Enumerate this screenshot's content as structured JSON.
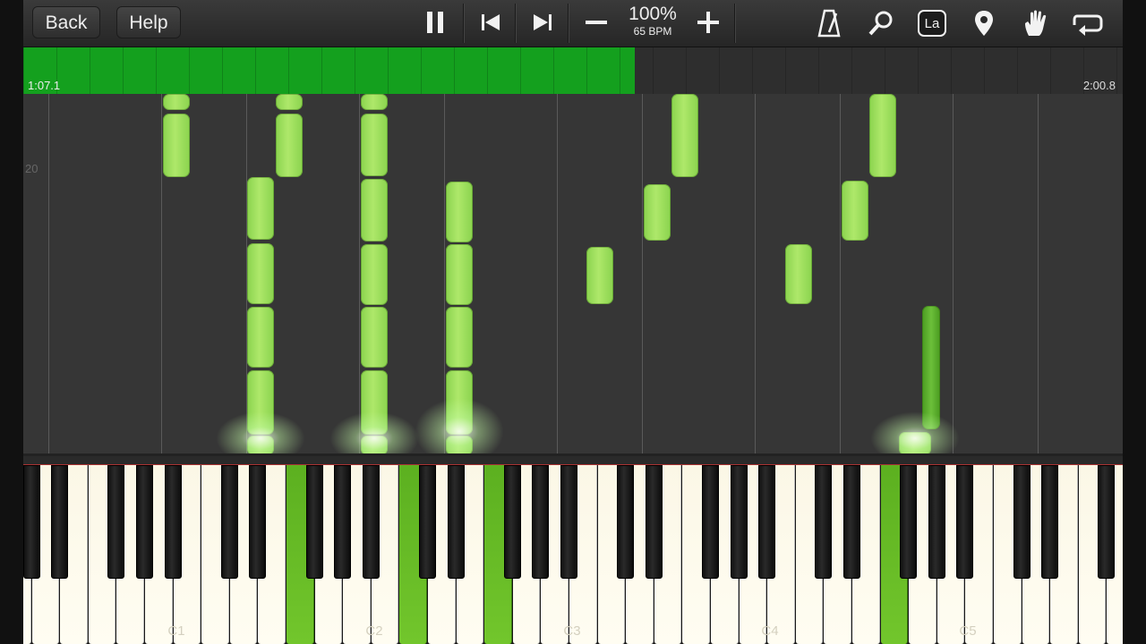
{
  "toolbar": {
    "back_label": "Back",
    "help_label": "Help",
    "speed_percent": "100%",
    "tempo": "65 BPM",
    "icons": [
      "pause-icon",
      "skip-back-icon",
      "skip-forward-icon",
      "minus-icon",
      "plus-icon",
      "metronome-icon",
      "magnifier-icon",
      "note-labels-icon",
      "location-pin-icon",
      "hand-icon",
      "loop-icon"
    ],
    "note_labels_badge": "La"
  },
  "progress": {
    "current_time": "1:07.1",
    "total_time": "2:00.8",
    "fraction": 0.556,
    "color": "#14a01e"
  },
  "note_field": {
    "measure_number": "20",
    "note_color": "#9ddc5c"
  },
  "keyboard": {
    "octave_labels": [
      "C1",
      "C2",
      "C3",
      "C4",
      "C5"
    ],
    "highlight_color": "#6ac028"
  }
}
